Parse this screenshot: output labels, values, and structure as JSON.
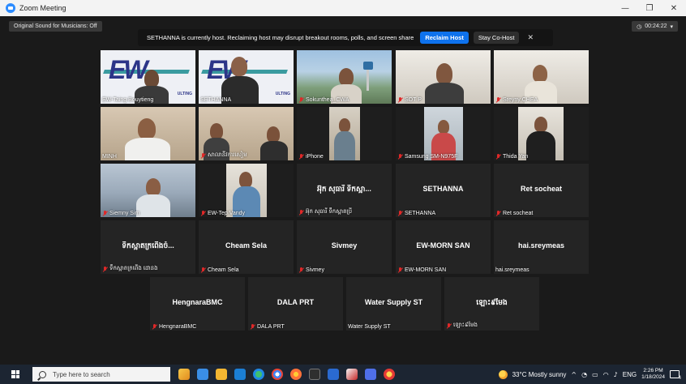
{
  "window": {
    "title": "Zoom Meeting",
    "minimize": "—",
    "restore": "❐",
    "close": "✕"
  },
  "toolbar": {
    "original_sound": "Original Sound for Musicians: Off",
    "timer": "00:24:22",
    "timer_caret": "▾"
  },
  "banner": {
    "message": "SETHANNA is currently host. Reclaiming host may disrupt breakout rooms, polls, and screen share",
    "reclaim_label": "Reclaim Host",
    "cohost_label": "Stay Co-Host",
    "close_label": "✕"
  },
  "participants": [
    {
      "name": "EW-Taing Bouytieng",
      "muted": false
    },
    {
      "name": "SETHANNA",
      "muted": false
    },
    {
      "name": "Sokunthea_CWA",
      "muted": true
    },
    {
      "name": "SOT P",
      "muted": true
    },
    {
      "name": "Sreyny CHEA",
      "muted": true
    },
    {
      "name": "MINH",
      "muted": false
    },
    {
      "name": "សាលានីវការសៀម",
      "muted": true
    },
    {
      "name": "iPhone",
      "muted": true
    },
    {
      "name": "Samsung SM-N975F",
      "muted": true
    },
    {
      "name": "Thida Yan",
      "muted": true
    },
    {
      "name": "Siemny Sim",
      "muted": true
    },
    {
      "name": "EW-Tep Vandy",
      "muted": true
    },
    {
      "name": "អ៊ុក សុធារី ទឹកស្អាតប្រី",
      "display": "អ៊ុក សុធារី ទឹកស្អា...",
      "muted": true
    },
    {
      "name": "SETHANNA",
      "display": "SETHANNA",
      "muted": true
    },
    {
      "name": "Ret socheat",
      "display": "Ret socheat",
      "muted": true
    },
    {
      "name": "ទឹកស្អាតក្រពើង ដោនង",
      "display": "ទឹកស្អាតក្រពើងចំ...",
      "muted": true
    },
    {
      "name": "Cheam Sela",
      "display": "Cheam Sela",
      "muted": true
    },
    {
      "name": "Sivmey",
      "display": "Sivmey",
      "muted": true
    },
    {
      "name": "EW-MORN SAN",
      "display": "EW-MORN SAN",
      "muted": true
    },
    {
      "name": "hai.sreymeas",
      "display": "hai.sreymeas",
      "muted": false
    },
    {
      "name": "HengnaraBMC",
      "display": "HengnaraBMC",
      "muted": true
    },
    {
      "name": "DALA PRT",
      "display": "DALA PRT",
      "muted": true
    },
    {
      "name": "Water Supply ST",
      "display": "Water Supply ST",
      "muted": false
    },
    {
      "name": "ឡោះ៩មែង",
      "display": "ឡោះ៩មែង",
      "muted": true
    }
  ],
  "logo": {
    "letters": "EW",
    "subtitle": "ULTING"
  },
  "taskbar": {
    "search_placeholder": "Type here to search",
    "weather": "33°C  Mostly sunny",
    "tray_arrow": "^",
    "language": "ENG",
    "time": "2:26 PM",
    "date": "1/18/2024",
    "notification_count": "4"
  },
  "colors": {
    "accent": "#0e72ed",
    "active_speaker": "#c8f05a",
    "muted": "#e02828"
  }
}
